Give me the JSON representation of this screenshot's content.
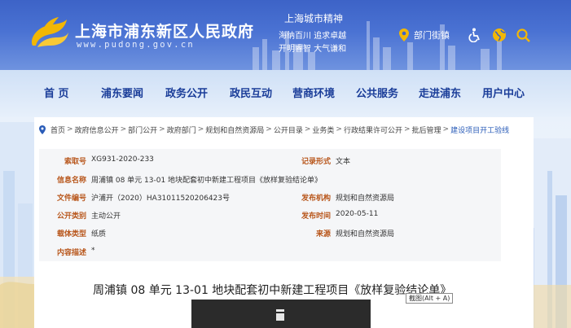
{
  "header": {
    "site_title": "上海市浦东新区人民政府",
    "site_domain": "www.pudong.gov.cn",
    "spirit_title": "上海城市精神",
    "spirit_line1": "海纳百川  追求卓越",
    "spirit_line2": "开明睿智  大气谦和",
    "location_label": "部门街镇",
    "icons": [
      "location-pin-icon",
      "accessibility-icon",
      "globe-icon",
      "search-icon"
    ]
  },
  "nav": {
    "items": [
      "首  页",
      "浦东要闻",
      "政务公开",
      "政民互动",
      "营商环境",
      "公共服务",
      "走进浦东",
      "用户中心"
    ]
  },
  "breadcrumb": {
    "items": [
      "首页",
      "政府信息公开",
      "部门公开",
      "政府部门",
      "规划和自然资源局",
      "公开目录",
      "业务类",
      "行政结果许可公开",
      "批后管理"
    ],
    "current": "建设项目开工验线"
  },
  "meta": {
    "index_label": "索取号",
    "index_value": "XG931-2020-233",
    "form_label": "记录形式",
    "form_value": "文本",
    "name_label": "信息名称",
    "name_value": "周浦镇 08 单元 13-01 地块配套初中新建工程项目《放样复验结论单》",
    "docno_label": "文件编号",
    "docno_value": "沪浦开（2020）HA31011520206423号",
    "org_label": "发布机构",
    "org_value": "规划和自然资源局",
    "category_label": "公开类别",
    "category_value": "主动公开",
    "date_label": "发布时间",
    "date_value": "2020-05-11",
    "carrier_label": "载体类型",
    "carrier_value": "纸质",
    "source_label": "来源",
    "source_value": "规划和自然资源局",
    "desc_label": "内容描述",
    "desc_value": "*"
  },
  "document": {
    "title": "周浦镇 08 单元 13-01 地块配套初中新建工程项目《放样复验结论单》",
    "tooltip": "截图(Alt + A)"
  },
  "colors": {
    "header_blue": "#3d63c7",
    "nav_text": "#1a3d99",
    "meta_label": "#b8561b",
    "link_blue": "#2a5cb8",
    "logo_gold": "#f2b705"
  }
}
